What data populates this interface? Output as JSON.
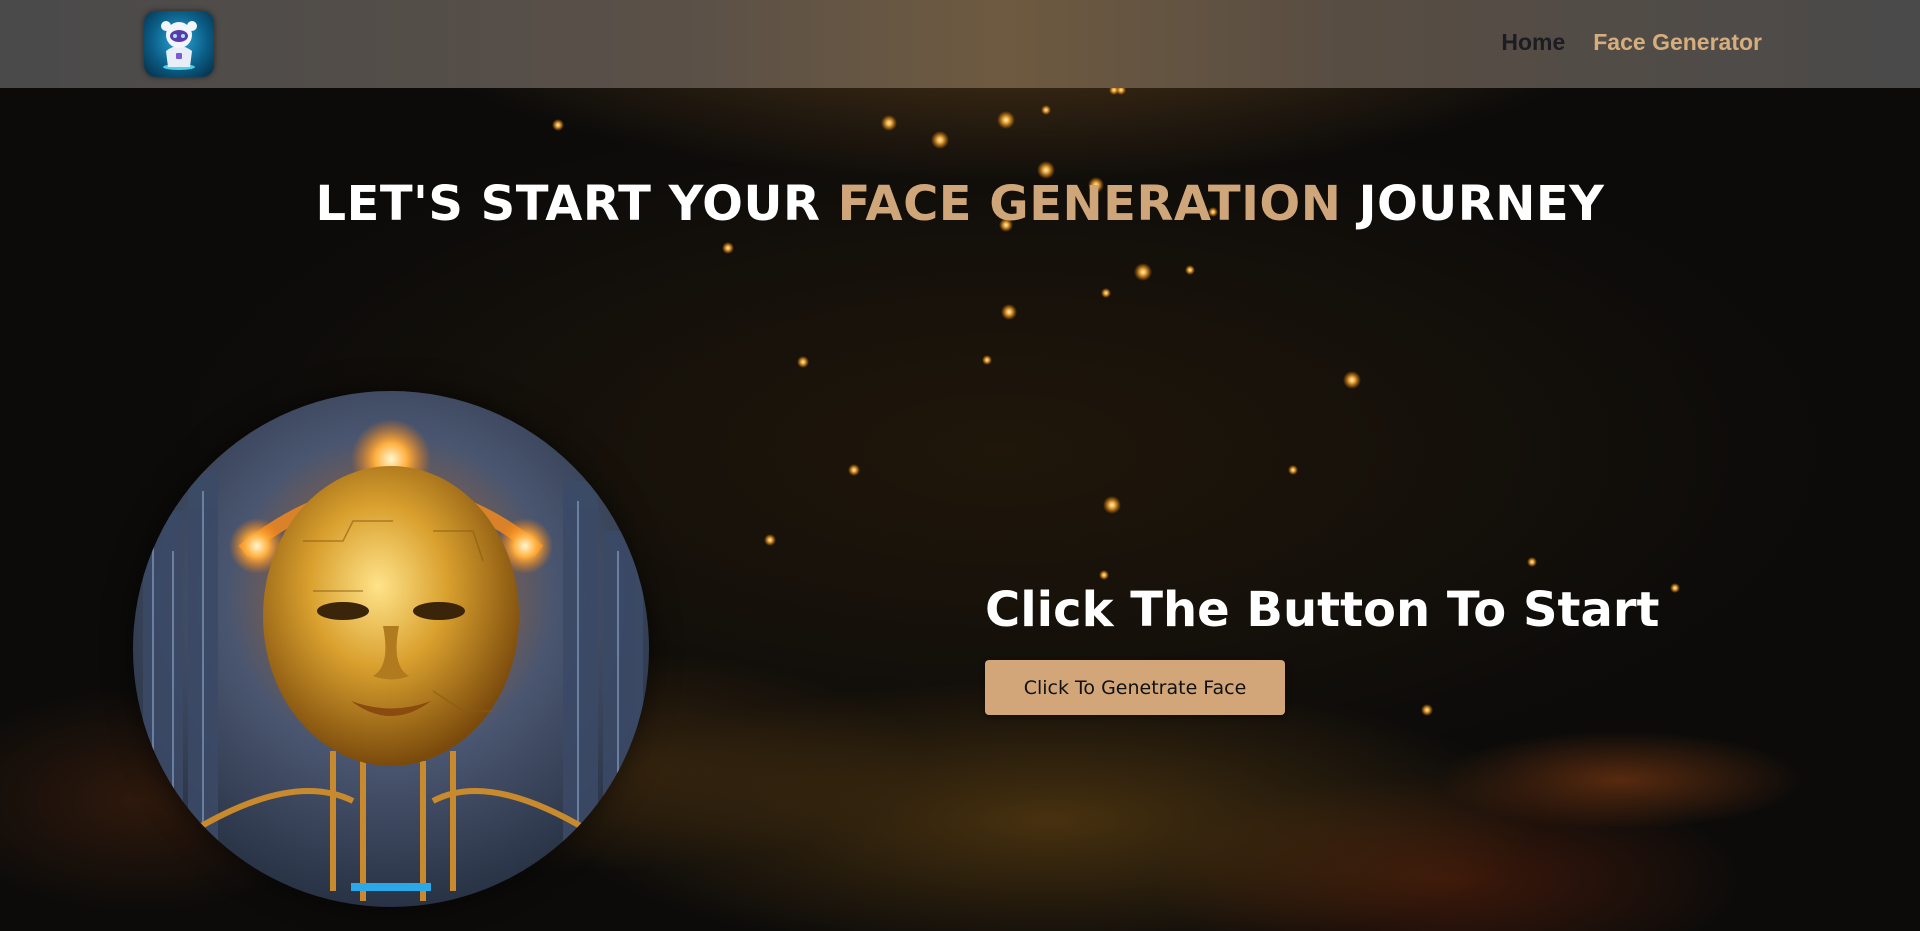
{
  "header": {
    "logo_icon": "robot-mascot-icon",
    "nav": {
      "home_label": "Home",
      "face_generator_label": "Face Generator"
    }
  },
  "hero": {
    "title_part1": "LET'S START YOUR ",
    "title_accent": "FACE GENERATION",
    "title_part2": " JOURNEY"
  },
  "portrait": {
    "image_icon": "golden-cyborg-face-image"
  },
  "cta": {
    "title": "Click The Button To Start",
    "button_label": "Click To Genetrate Face"
  },
  "colors": {
    "accent": "#cfa57a",
    "button_bg": "#d2a679",
    "nav_active": "#d6ae7d",
    "nav_home": "#1c1c22"
  }
}
